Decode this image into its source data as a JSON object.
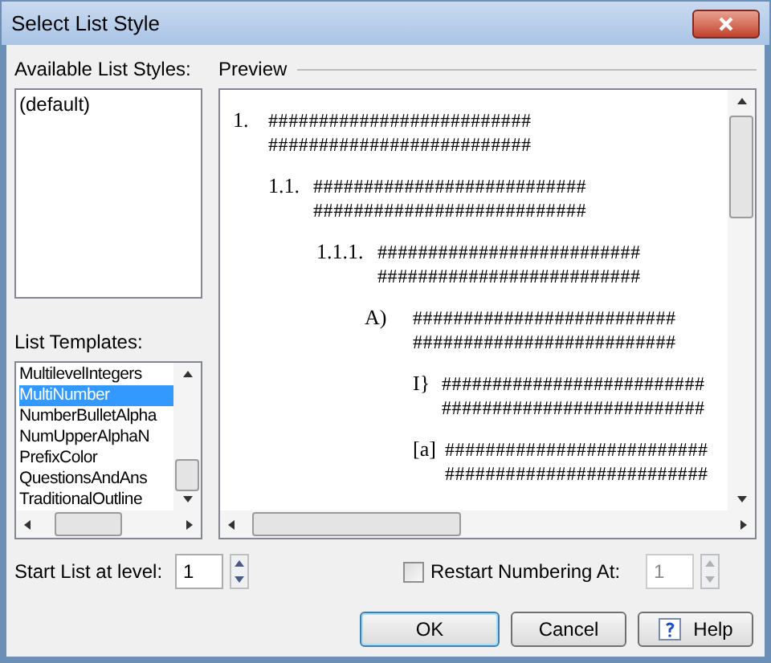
{
  "window": {
    "title": "Select List Style"
  },
  "available_styles": {
    "label": "Available List Styles:",
    "items": [
      {
        "text": "(default)",
        "selected": false
      }
    ]
  },
  "templates": {
    "label": "List Templates:",
    "items": [
      {
        "text": "MultilevelIntegers",
        "selected": false
      },
      {
        "text": "MultiNumber",
        "selected": true
      },
      {
        "text": "NumberBulletAlpha",
        "selected": false
      },
      {
        "text": "NumUpperAlphaN",
        "selected": false
      },
      {
        "text": "PrefixColor",
        "selected": false
      },
      {
        "text": "QuestionsAndAns",
        "selected": false
      },
      {
        "text": "TraditionalOutline",
        "selected": false
      }
    ]
  },
  "preview": {
    "label": "Preview",
    "levels": [
      {
        "marker": "1.",
        "lines": [
          "##########################",
          "##########################"
        ]
      },
      {
        "marker": "1.1.",
        "lines": [
          "###########################",
          "###########################"
        ]
      },
      {
        "marker": "1.1.1.",
        "lines": [
          "##########################",
          "##########################"
        ]
      },
      {
        "marker": "A)",
        "lines": [
          "##########################",
          "##########################"
        ]
      },
      {
        "marker": "I}",
        "lines": [
          "##########################",
          "##########################"
        ]
      },
      {
        "marker": "[a]",
        "lines": [
          "##########################",
          "##########################"
        ]
      }
    ]
  },
  "start_level": {
    "label": "Start List at  level:",
    "value": "1"
  },
  "restart": {
    "label": "Restart Numbering At:",
    "checked": false,
    "value": "1",
    "disabled": true
  },
  "buttons": [
    {
      "label": "OK",
      "kind": "default"
    },
    {
      "label": "Cancel",
      "kind": "plain"
    },
    {
      "label": "Help",
      "kind": "help"
    }
  ]
}
